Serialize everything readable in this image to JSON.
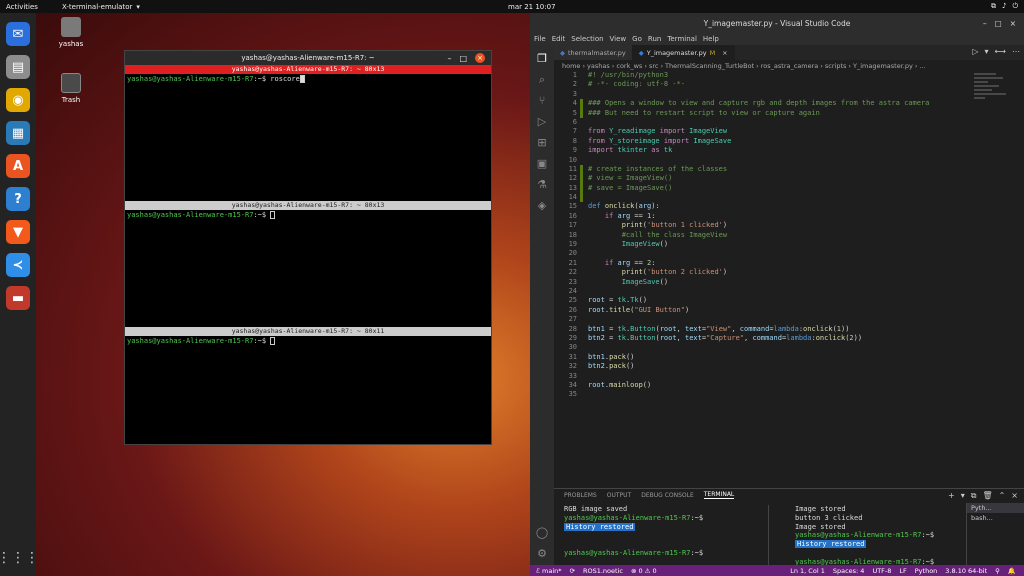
{
  "topbar": {
    "activities": "Activities",
    "app": "X-terminal-emulator",
    "app_arrow": "▾",
    "clock": "mar 21  10:07",
    "sys_icons": [
      "network-icon",
      "volume-icon",
      "power-icon"
    ],
    "sys_glyphs": [
      "⧉",
      "♪",
      "⏻"
    ]
  },
  "desktop": {
    "home_label": "yashas",
    "trash_label": "Trash"
  },
  "dock": {
    "items": [
      {
        "name": "thunderbird-icon",
        "glyph": "✉",
        "color": "#2a6fdb"
      },
      {
        "name": "files-icon",
        "glyph": "▤",
        "color": "#8d8d8d"
      },
      {
        "name": "rhythmbox-icon",
        "glyph": "◉",
        "color": "#e0a800"
      },
      {
        "name": "writer-icon",
        "glyph": "▦",
        "color": "#2a7ab8"
      },
      {
        "name": "software-icon",
        "glyph": "A",
        "color": "#e95420"
      },
      {
        "name": "help-icon",
        "glyph": "?",
        "color": "#2f7fd0"
      },
      {
        "name": "brave-icon",
        "glyph": "▼",
        "color": "#f25a1c"
      },
      {
        "name": "vscode-icon",
        "glyph": "≺",
        "color": "#2f8ee8"
      },
      {
        "name": "terminal-icon",
        "glyph": "▬",
        "color": "#c0392b"
      }
    ],
    "grid_glyph": "⋮⋮⋮"
  },
  "terminal": {
    "title": "yashas@yashas-Alienware-m15-R7: ~",
    "btns": [
      "–",
      "□",
      "×"
    ],
    "panes": [
      {
        "header": "yashas@yashas-Alienware-m15-R7: ~ 80x13",
        "prompt": "yashas@yashas-Alienware-m15-R7",
        "rest": ":~$ ",
        "cmd": "roscore"
      },
      {
        "header": "yashas@yashas-Alienware-m15-R7: ~ 80x13",
        "prompt": "yashas@yashas-Alienware-m15-R7",
        "rest": ":~$ ",
        "cmd": ""
      },
      {
        "header": "yashas@yashas-Alienware-m15-R7: ~ 80x11",
        "prompt": "yashas@yashas-Alienware-m15-R7",
        "rest": ":~$ ",
        "cmd": ""
      }
    ]
  },
  "vscode": {
    "title": "Y_imagemaster.py - Visual Studio Code",
    "window_btns": [
      "–",
      "□",
      "×"
    ],
    "menu": [
      "File",
      "Edit",
      "Selection",
      "View",
      "Go",
      "Run",
      "Terminal",
      "Help"
    ],
    "activity": [
      {
        "name": "explorer-icon",
        "glyph": "❐"
      },
      {
        "name": "search-icon",
        "glyph": "⌕"
      },
      {
        "name": "source-control-icon",
        "glyph": "⑂"
      },
      {
        "name": "run-debug-icon",
        "glyph": "▷"
      },
      {
        "name": "extensions-icon",
        "glyph": "⊞"
      },
      {
        "name": "remote-explorer-icon",
        "glyph": "▣"
      },
      {
        "name": "testing-icon",
        "glyph": "⚗"
      },
      {
        "name": "docker-icon",
        "glyph": "◈"
      }
    ],
    "activity_bottom": [
      {
        "name": "accounts-icon",
        "glyph": "◯"
      },
      {
        "name": "manage-gear-icon",
        "glyph": "⚙"
      }
    ],
    "tabs": [
      {
        "label": "thermalmaster.py",
        "mark": "",
        "active": false
      },
      {
        "label": "Y_imagemaster.py",
        "mark": "M",
        "active": true
      }
    ],
    "tab_close": "×",
    "editor_tools": [
      "▷",
      "▾",
      "⟷",
      "⋯"
    ],
    "breadcrumb": [
      "home",
      "yashas",
      "cork_ws",
      "src",
      "ThermalScanning_TurtleBot",
      "ros_astra_camera",
      "scripts",
      "Y_imagemaster.py",
      "..."
    ],
    "lines": [
      {
        "n": "1",
        "html": "<span class='cm'>#! /usr/bin/python3</span>"
      },
      {
        "n": "2",
        "html": "<span class='cm'># -*- coding: utf-8 -*-</span>"
      },
      {
        "n": "3",
        "html": ""
      },
      {
        "n": "4",
        "html": "<span class='cm'>### Opens a window to view and capture rgb and depth images from the astra camera</span>",
        "mod": true
      },
      {
        "n": "5",
        "html": "<span class='cm'>### But need to restart script to view or capture again</span>",
        "mod": true
      },
      {
        "n": "6",
        "html": ""
      },
      {
        "n": "7",
        "html": "<span class='kw'>from</span> <span class='cl'>Y_readimage</span> <span class='kw'>import</span> <span class='cl'>ImageView</span>"
      },
      {
        "n": "8",
        "html": "<span class='kw'>from</span> <span class='cl'>Y_storeimage</span> <span class='kw'>import</span> <span class='cl'>ImageSave</span>"
      },
      {
        "n": "9",
        "html": "<span class='kw'>import</span> <span class='cl'>tkinter</span> <span class='kw'>as</span> <span class='cl'>tk</span>"
      },
      {
        "n": "10",
        "html": ""
      },
      {
        "n": "11",
        "html": "<span class='cm'># create instances of the classes</span>",
        "mod": true
      },
      {
        "n": "12",
        "html": "<span class='cm'># view = ImageView()</span>",
        "mod": true
      },
      {
        "n": "13",
        "html": "<span class='cm'># save = ImageSave()</span>",
        "mod": true
      },
      {
        "n": "14",
        "html": "",
        "mod": true
      },
      {
        "n": "15",
        "html": "<span class='bl'>def</span> <span class='fn'>onclick</span>(<span class='vr'>arg</span>):"
      },
      {
        "n": "16",
        "html": "    <span class='kw'>if</span> <span class='vr'>arg</span> == <span class='nm'>1</span>:"
      },
      {
        "n": "17",
        "html": "        <span class='fn'>print</span>(<span class='st'>'button 1 clicked'</span>)"
      },
      {
        "n": "18",
        "html": "        <span class='cm'>#call the class ImageView</span>"
      },
      {
        "n": "19",
        "html": "        <span class='cl'>ImageView</span>()"
      },
      {
        "n": "20",
        "html": ""
      },
      {
        "n": "21",
        "html": "    <span class='kw'>if</span> <span class='vr'>arg</span> == <span class='nm'>2</span>:"
      },
      {
        "n": "22",
        "html": "        <span class='fn'>print</span>(<span class='st'>'button 2 clicked'</span>)"
      },
      {
        "n": "23",
        "html": "        <span class='cl'>ImageSave</span>()"
      },
      {
        "n": "24",
        "html": ""
      },
      {
        "n": "25",
        "html": "<span class='vr'>root</span> = <span class='cl'>tk</span>.<span class='cl'>Tk</span>()"
      },
      {
        "n": "26",
        "html": "<span class='vr'>root</span>.<span class='fn'>title</span>(<span class='st'>\"GUI Button\"</span>)"
      },
      {
        "n": "27",
        "html": ""
      },
      {
        "n": "28",
        "html": "<span class='vr'>btn1</span> = <span class='cl'>tk</span>.<span class='cl'>Button</span>(<span class='vr'>root</span>, <span class='vr'>text</span>=<span class='st'>\"View\"</span>, <span class='vr'>command</span>=<span class='bl'>lambda</span>:<span class='fn'>onclick</span>(<span class='nm'>1</span>))"
      },
      {
        "n": "29",
        "html": "<span class='vr'>btn2</span> = <span class='cl'>tk</span>.<span class='cl'>Button</span>(<span class='vr'>root</span>, <span class='vr'>text</span>=<span class='st'>\"Capture\"</span>, <span class='vr'>command</span>=<span class='bl'>lambda</span>:<span class='fn'>onclick</span>(<span class='nm'>2</span>))"
      },
      {
        "n": "30",
        "html": ""
      },
      {
        "n": "31",
        "html": "<span class='vr'>btn1</span>.<span class='fn'>pack</span>()"
      },
      {
        "n": "32",
        "html": "<span class='vr'>btn2</span>.<span class='fn'>pack</span>()"
      },
      {
        "n": "33",
        "html": ""
      },
      {
        "n": "34",
        "html": "<span class='vr'>root</span>.<span class='fn'>mainloop</span>()"
      },
      {
        "n": "35",
        "html": ""
      }
    ],
    "panel_tabs": [
      "PROBLEMS",
      "OUTPUT",
      "DEBUG CONSOLE",
      "TERMINAL"
    ],
    "panel_tools": [
      "+",
      "▾",
      "⧉",
      "🗑",
      "⌃",
      "×"
    ],
    "term_left": [
      {
        "t": "RGB image saved"
      },
      {
        "p": "yashas@yashas-Alienware-m15-R7",
        "r": ":~$"
      },
      {
        "h": "History restored"
      },
      {
        "t": ""
      },
      {
        "t": ""
      },
      {
        "p": "yashas@yashas-Alienware-m15-R7",
        "r": ":~$"
      }
    ],
    "term_right": [
      {
        "t": "Image stored"
      },
      {
        "t": "button 3 clicked"
      },
      {
        "t": "Image stored"
      },
      {
        "p": "yashas@yashas-Alienware-m15-R7",
        "r": ":~$"
      },
      {
        "h": "History restored"
      },
      {
        "t": ""
      },
      {
        "p": "yashas@yashas-Alienware-m15-R7",
        "r": ":~$"
      }
    ],
    "term_list": [
      "Pyth...",
      "bash..."
    ],
    "status_left": [
      "ℰ main*",
      "⟳",
      "ROS1.noetic",
      "⊗ 0 ⚠ 0"
    ],
    "status_right": [
      "Ln 1, Col 1",
      "Spaces: 4",
      "UTF-8",
      "LF",
      "Python",
      "3.8.10 64-bit",
      "⚲",
      "🔔"
    ]
  }
}
